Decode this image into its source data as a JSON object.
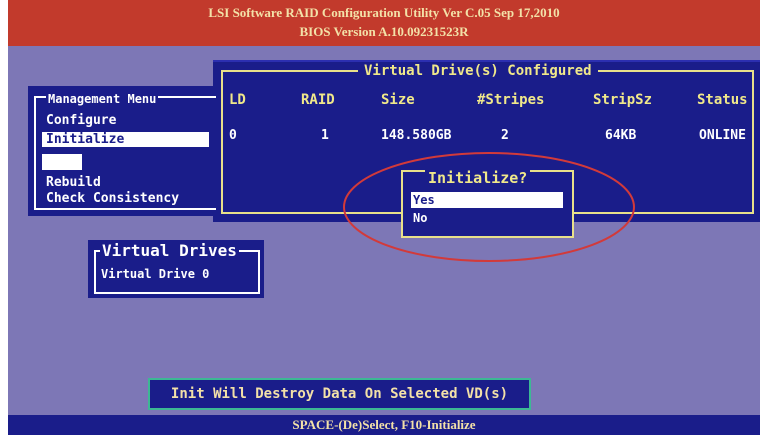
{
  "header": {
    "title_line1": "LSI Software RAID Configuration Utility Ver C.05 Sep 17,2010",
    "title_line2": "BIOS Version  A.10.09231523R"
  },
  "vd_table": {
    "title": "Virtual Drive(s) Configured",
    "columns": [
      "LD",
      "RAID",
      "Size",
      "#Stripes",
      "StripSz",
      "Status"
    ],
    "rows": [
      [
        "0",
        "1",
        "148.580GB",
        "2",
        "64KB",
        "ONLINE"
      ]
    ]
  },
  "management_menu": {
    "title": "Management Menu",
    "items": [
      "Configure",
      "Initialize",
      "",
      "Rebuild",
      "Check Consistency"
    ],
    "selected": "Initialize"
  },
  "virtual_drives": {
    "title": "Virtual Drives",
    "items": [
      "Virtual Drive 0"
    ]
  },
  "dialog": {
    "title": "Initialize?",
    "options": [
      "Yes",
      "No"
    ],
    "selected": "Yes"
  },
  "warning": "Init Will Destroy Data On Selected VD(s)",
  "status_bar": "SPACE-(De)Select, F10-Initialize",
  "colors": {
    "background": "#7d77b6",
    "panel": "#1a1d8a",
    "title_bar": "#c23a2c",
    "highlight_text": "#f0e88a",
    "ellipse": "#d23a3a",
    "warning_border": "#3cb894"
  }
}
